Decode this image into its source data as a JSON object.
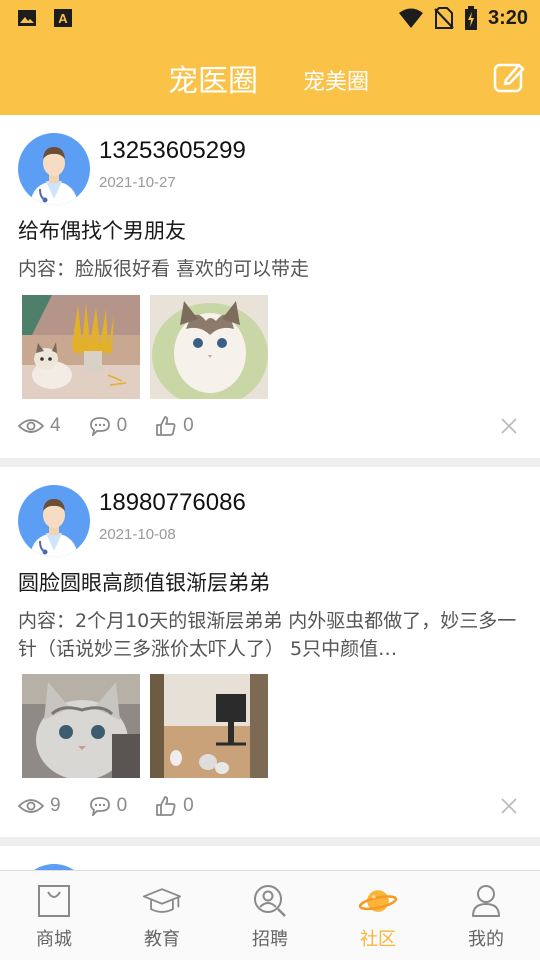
{
  "status_bar": {
    "time": "3:20",
    "icons": [
      "image-icon",
      "a-box-icon",
      "wifi-icon",
      "no-sim-icon",
      "battery-charging-icon"
    ]
  },
  "header": {
    "active_tab": "宠医圈",
    "other_tab": "宠美圈",
    "edit_icon": "edit-icon"
  },
  "posts": [
    {
      "username": "13253605299",
      "date": "2021-10-27",
      "title": "给布偶找个男朋友",
      "content": "内容：脸版很好看 喜欢的可以带走",
      "views": "4",
      "comments": "0",
      "likes": "0"
    },
    {
      "username": "18980776086",
      "date": "2021-10-08",
      "title": "圆脸圆眼高颜值银渐层弟弟",
      "content": "内容：2个月10天的银渐层弟弟 内外驱虫都做了，妙三多一针（话说妙三多涨价太吓人了） 5只中颜值…",
      "views": "9",
      "comments": "0",
      "likes": "0"
    }
  ],
  "nav": {
    "items": [
      {
        "label": "商城",
        "icon": "shopping-bag-icon"
      },
      {
        "label": "教育",
        "icon": "graduation-cap-icon"
      },
      {
        "label": "招聘",
        "icon": "search-person-icon"
      },
      {
        "label": "社区",
        "icon": "planet-icon"
      },
      {
        "label": "我的",
        "icon": "person-icon"
      }
    ],
    "active_index": 3
  },
  "colors": {
    "brand_yellow": "#fbc248",
    "active_nav": "#fbb43a",
    "avatar_blue": "#5b9ef3"
  }
}
